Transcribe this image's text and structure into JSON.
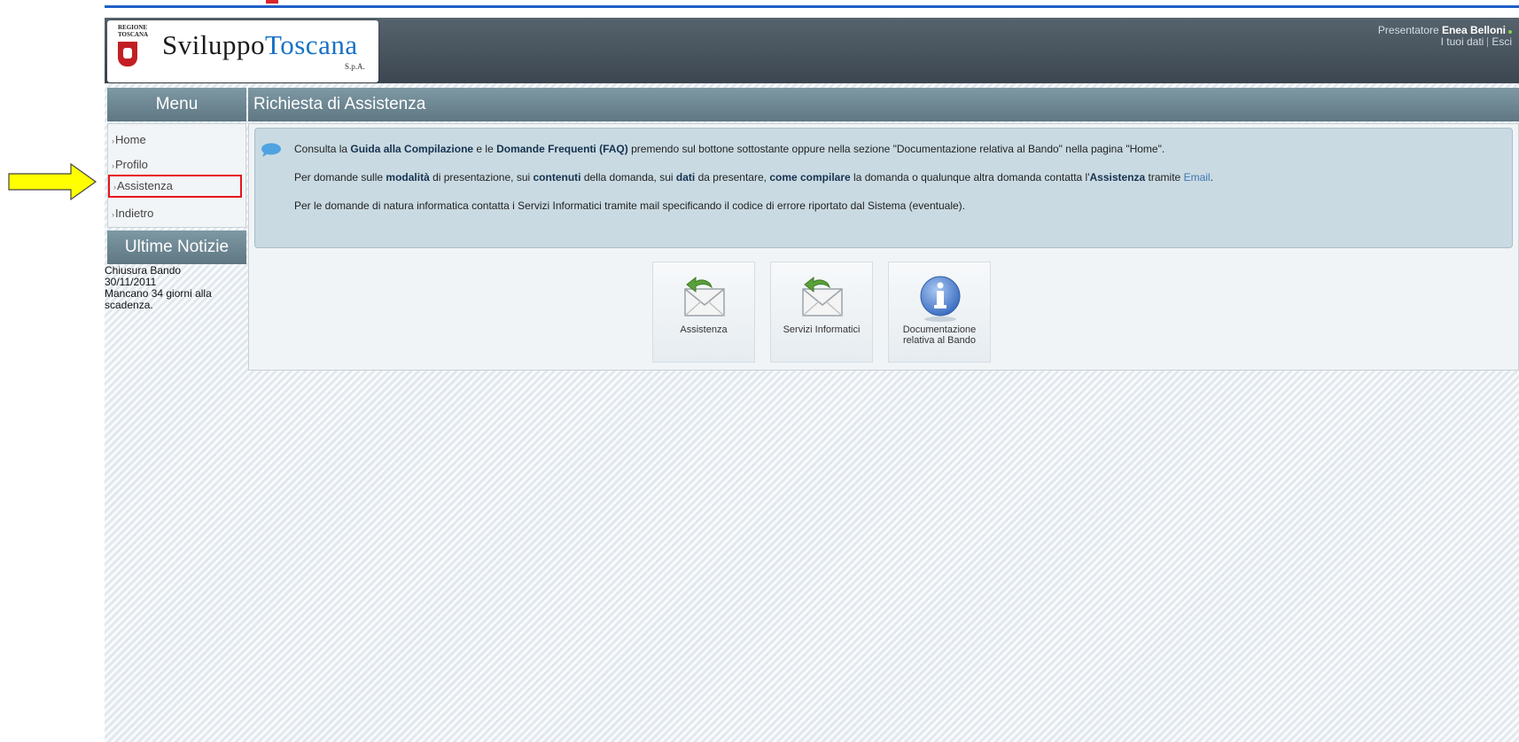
{
  "header": {
    "brand_part1": "Sviluppo",
    "brand_part2": "Toscana",
    "brand_suffix": "S.p.A.",
    "crest_line1": "REGIONE",
    "crest_line2": "TOSCANA",
    "presenter_prefix": "Presentatore",
    "presenter_name": "Enea Belloni",
    "link_your_data": "I tuoi dati",
    "link_exit": "Esci"
  },
  "menu": {
    "title": "Menu",
    "items": [
      {
        "label": "Home"
      },
      {
        "label": "Profilo"
      },
      {
        "label": "Assistenza"
      },
      {
        "label": "Indietro"
      }
    ]
  },
  "news": {
    "title": "Ultime Notizie",
    "line1": "Chiusura Bando",
    "line2": "30/11/2011",
    "line3": "Mancano 34 giorni alla",
    "line4": "scadenza."
  },
  "content": {
    "title": "Richiesta di Assistenza",
    "info": {
      "l1_a": "Consulta la ",
      "l1_b": "Guida alla Compilazione",
      "l1_c": " e le ",
      "l1_d": "Domande Frequenti (FAQ)",
      "l1_e": " premendo sul bottone sottostante oppure nella sezione \"Documentazione relativa al Bando\" nella pagina \"Home\".",
      "l2_a": "Per domande sulle ",
      "l2_b": "modalità",
      "l2_c": " di presentazione, sui ",
      "l2_d": "contenuti",
      "l2_e": " della domanda, sui ",
      "l2_f": "dati",
      "l2_g": " da presentare, ",
      "l2_h": "come compilare",
      "l2_i": " la domanda o qualunque altra domanda contatta l'",
      "l2_j": "Assistenza",
      "l2_k": " tramite ",
      "l2_l": "Email",
      "l2_m": ".",
      "l3": "Per le domande di natura informatica contatta i Servizi Informatici tramite mail specificando il codice di errore riportato dal Sistema (eventuale)."
    },
    "tiles": [
      {
        "line1": "Assistenza",
        "line2": "",
        "icon": "envelope-reply-icon"
      },
      {
        "line1": "Servizi Informatici",
        "line2": "",
        "icon": "envelope-reply-icon"
      },
      {
        "line1": "Documentazione",
        "line2": "relativa al Bando",
        "icon": "info-icon"
      }
    ]
  },
  "colors": {
    "header_bg": "#3b4650",
    "section_head": "#6b8591",
    "highlight": "#e8131b",
    "arrow": "#ffff00"
  }
}
